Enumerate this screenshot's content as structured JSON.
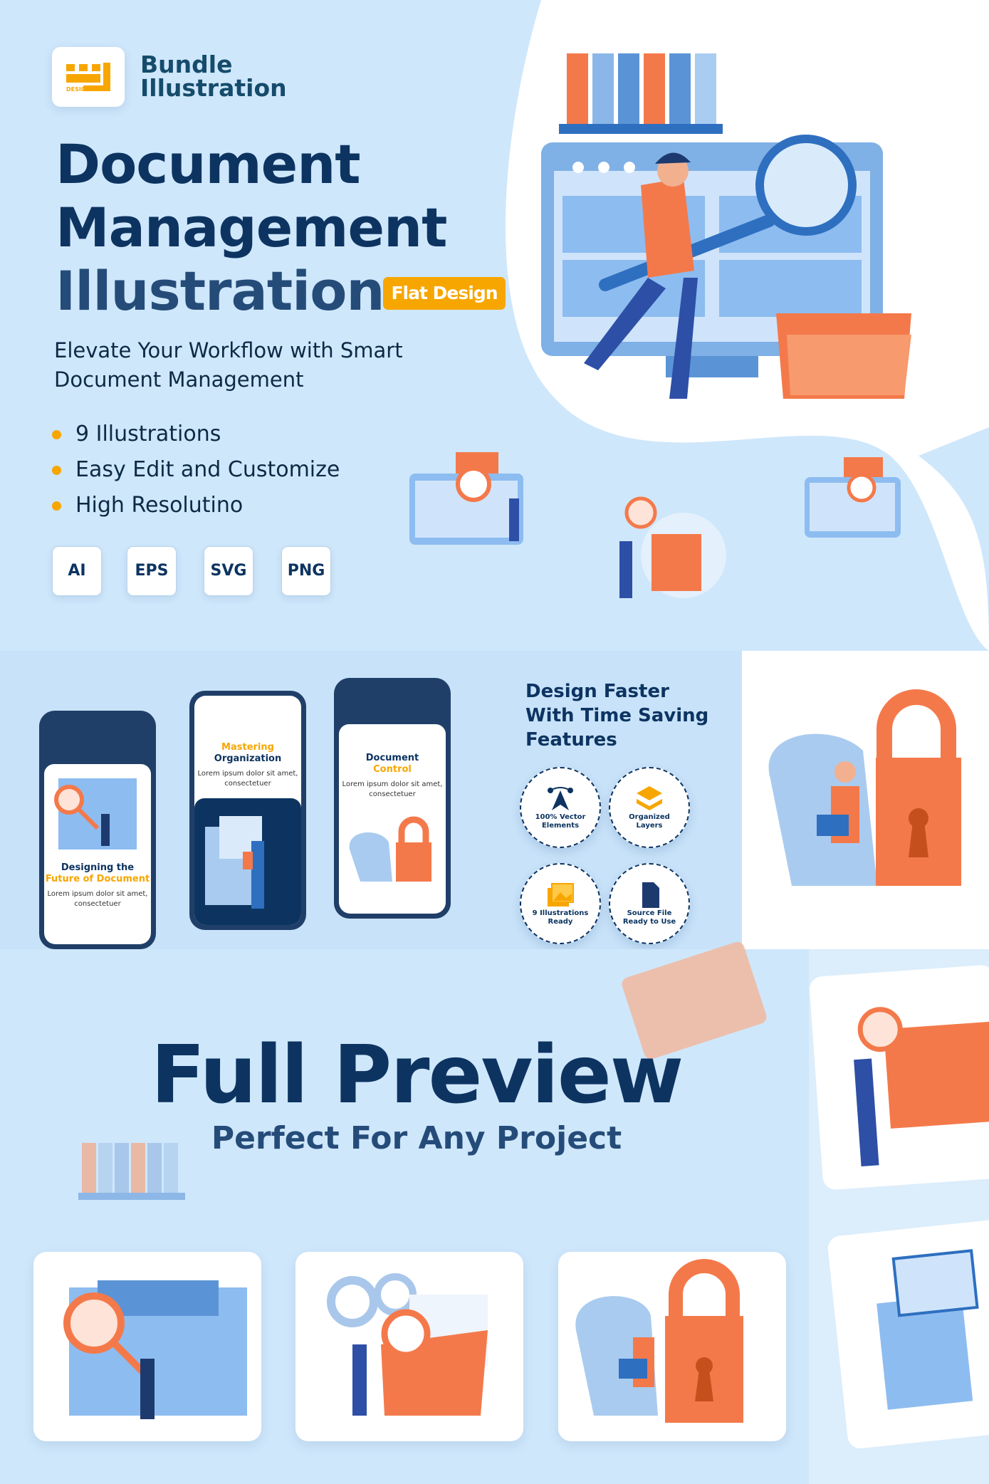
{
  "brand": {
    "logo_text": "DESIGN",
    "line1": "Bundle",
    "line2": "Illustration"
  },
  "title": {
    "line1": "Document",
    "line2": "Management",
    "line3": "Illustration",
    "badge": "Flat Design"
  },
  "subtitle": {
    "line1": "Elevate Your Workflow with Smart",
    "line2": "Document Management"
  },
  "bullets": [
    "9 Illustrations",
    "Easy Edit and Customize",
    "High Resolutino"
  ],
  "formats": [
    "AI",
    "EPS",
    "SVG",
    "PNG"
  ],
  "phones": [
    {
      "title": "Designing the",
      "title_accent": "Future of Document",
      "body": "Lorem ipsum dolor sit amet, consectetuer"
    },
    {
      "title_accent": "Mastering",
      "title": "Organization",
      "body": "Lorem ipsum dolor sit amet, consectetuer"
    },
    {
      "title": "Document",
      "title_accent": "Control",
      "body": "Lorem ipsum dolor sit amet, consectetuer"
    }
  ],
  "features": {
    "heading": [
      "Design Faster",
      "With Time Saving",
      "Features"
    ],
    "items": [
      {
        "icon": "vector-pen-icon",
        "line1": "100% Vector",
        "line2": "Elements"
      },
      {
        "icon": "layers-icon",
        "line1": "Organized",
        "line2": "Layers"
      },
      {
        "icon": "image-icon",
        "line1": "9 Illustrations",
        "line2": "Ready"
      },
      {
        "icon": "file-icon",
        "line1": "Source File",
        "line2": "Ready to Use"
      }
    ]
  },
  "preview": {
    "title": "Full Preview",
    "subtitle": "Perfect For Any Project"
  },
  "colors": {
    "navy": "#0d3461",
    "orange": "#f7a600",
    "coral": "#f4794a",
    "light_blue": "#cfe7fb"
  }
}
